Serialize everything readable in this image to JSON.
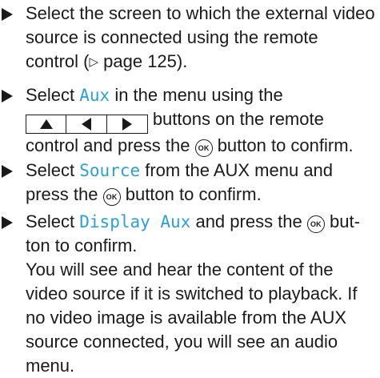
{
  "steps": [
    {
      "text_1": "Select the screen to which the external video source is connected using the remote control (",
      "page_ref_symbol": "▷",
      "page_ref_text": " page 125)."
    },
    {
      "text_1": "Select ",
      "highlight": "Aux",
      "text_2": " in the menu using the",
      "keys": [
        "up-arrow-key",
        "left-arrow-key",
        "right-arrow-key"
      ],
      "text_3": "buttons on the remote control and press the ",
      "ok_label": "OK",
      "text_4": " button to confirm."
    },
    {
      "text_1": "Select ",
      "highlight": "Source",
      "text_2": " from the AUX menu and press the ",
      "ok_label": "OK",
      "text_3": " button to confirm."
    },
    {
      "text_1": "Select ",
      "highlight": "Display Aux",
      "text_2": " and press the ",
      "ok_label": "OK",
      "text_3": " but-ton to confirm.",
      "note": "You will see and hear the content of the video source if it is switched to playback. If no video image is available from the AUX source connected, you will see an audio menu."
    }
  ],
  "colors": {
    "highlight": "#2aa0d8",
    "text": "#1a1a1a"
  }
}
